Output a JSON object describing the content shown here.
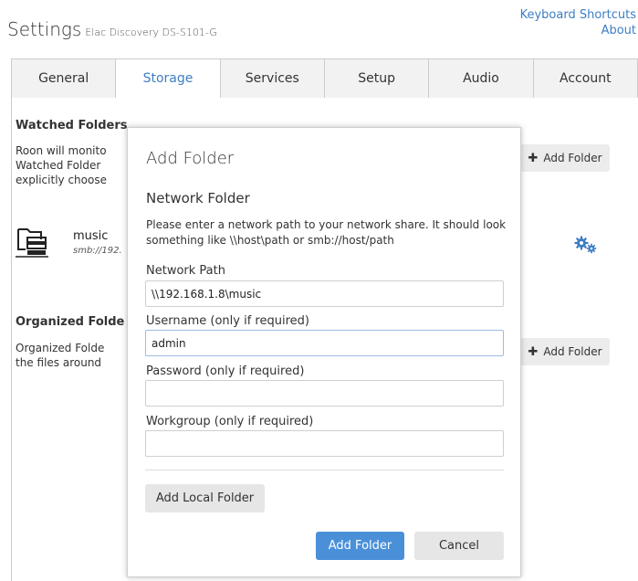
{
  "header": {
    "title": "Settings",
    "device": "Elac Discovery DS-S101-G",
    "links": [
      "Keyboard Shortcuts",
      "About"
    ]
  },
  "tabs": [
    {
      "label": "General",
      "active": false
    },
    {
      "label": "Storage",
      "active": true
    },
    {
      "label": "Services",
      "active": false
    },
    {
      "label": "Setup",
      "active": false
    },
    {
      "label": "Audio",
      "active": false
    },
    {
      "label": "Account",
      "active": false
    }
  ],
  "storage": {
    "watched": {
      "title": "Watched Folders",
      "text": "Roon will monito\nWatched Folder\nexplicitly choose",
      "add_label": "Add Folder"
    },
    "folder": {
      "name": "music",
      "path": "smb://192."
    },
    "organized": {
      "title": "Organized Folde",
      "text": "Organized Folde\nthe files around",
      "add_label": "Add Folder"
    }
  },
  "modal": {
    "title": "Add Folder",
    "subtitle": "Network Folder",
    "description": "Please enter a network path to your network share. It should look something like \\\\host\\path or smb://host/path",
    "fields": [
      {
        "label": "Network Path",
        "value": "\\\\192.168.1.8\\music"
      },
      {
        "label": "Username (only if required)",
        "value": "admin"
      },
      {
        "label": "Password (only if required)",
        "value": ""
      },
      {
        "label": "Workgroup (only if required)",
        "value": ""
      }
    ],
    "local_button": "Add Local Folder",
    "submit_button": "Add Folder",
    "cancel_button": "Cancel"
  },
  "colors": {
    "accent": "#3d7ec4",
    "primary_button": "#4a90d9"
  },
  "icons": [
    "folder-server-icon",
    "gears-icon",
    "plus-icon"
  ]
}
